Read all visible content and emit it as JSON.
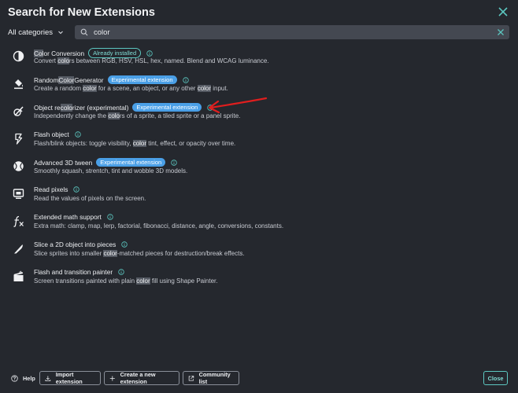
{
  "dialog": {
    "title": "Search for New Extensions"
  },
  "toolbar": {
    "category_value": "All categories",
    "search_value": "color"
  },
  "extensions": [
    {
      "name_parts": [
        "",
        "Col",
        "or Conversion"
      ],
      "badge": "Already installed",
      "badge_type": "installed",
      "desc_parts": [
        "Convert ",
        "colo",
        "rs between RGB, HSV, HSL, hex, named. Blend and WCAG luminance."
      ],
      "icon": "half-circle-icon"
    },
    {
      "name_parts": [
        "Random ",
        "Color",
        " Generator"
      ],
      "badge": "Experimental extension",
      "badge_type": "exp",
      "desc_parts": [
        "Create a random ",
        "color",
        " for a scene, an object, or any other ",
        "color",
        " input."
      ],
      "icon": "paint-bucket-icon"
    },
    {
      "name_parts": [
        "Object re",
        "colo",
        "rizer (experimental)"
      ],
      "badge": "Experimental extension",
      "badge_type": "exp",
      "desc_parts": [
        "Independently change the ",
        "colo",
        "rs of a sprite, a tiled sprite or a panel sprite."
      ],
      "icon": "recolor-icon"
    },
    {
      "name_parts": [
        "Flash object"
      ],
      "badge": "",
      "badge_type": "",
      "desc_parts": [
        "Flash/blink objects: toggle visibility, ",
        "color",
        " tint, effect, or opacity over time."
      ],
      "icon": "lightning-icon"
    },
    {
      "name_parts": [
        "Advanced 3D tween"
      ],
      "badge": "Experimental extension",
      "badge_type": "exp",
      "desc_parts": [
        "Smoothly squash, strentch, tint and wobble 3D models."
      ],
      "icon": "ball-icon"
    },
    {
      "name_parts": [
        "Read pixels"
      ],
      "badge": "",
      "badge_type": "",
      "desc_parts": [
        "Read the values of pixels on the screen."
      ],
      "icon": "monitor-icon"
    },
    {
      "name_parts": [
        "Extended math support"
      ],
      "badge": "",
      "badge_type": "",
      "desc_parts": [
        "Extra math: clamp, map, lerp, factorial, fibonacci, distance, angle, conversions, constants."
      ],
      "icon": "function-icon"
    },
    {
      "name_parts": [
        "Slice a 2D object into pieces"
      ],
      "badge": "",
      "badge_type": "",
      "desc_parts": [
        "Slice sprites into smaller ",
        "color",
        "-matched pieces for destruction/break effects."
      ],
      "icon": "blade-icon"
    },
    {
      "name_parts": [
        "Flash and transition painter"
      ],
      "badge": "",
      "badge_type": "",
      "desc_parts": [
        "Screen transitions painted with plain ",
        "color",
        " fill using Shape Painter."
      ],
      "icon": "clapperboard-icon"
    }
  ],
  "footer": {
    "help_label": "Help",
    "import_label": "Import extension",
    "create_label": "Create a new extension",
    "community_label": "Community list",
    "close_label": "Close"
  },
  "colors": {
    "background": "#25282e",
    "accent_teal": "#5cc7c0",
    "badge_blue": "#4a9fe6",
    "highlight": "#555a63",
    "annotation_red": "#e01e1e"
  }
}
